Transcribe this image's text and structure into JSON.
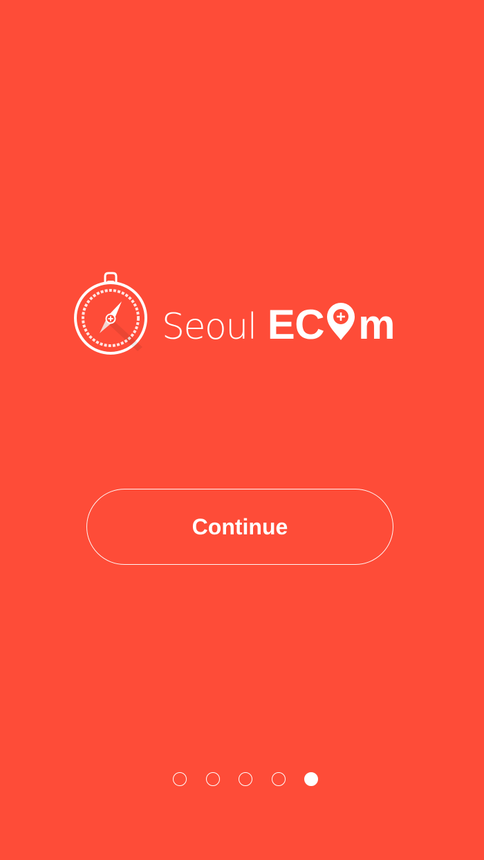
{
  "colors": {
    "background": "#FE4C38",
    "foreground": "#FFFFFF"
  },
  "logo": {
    "icon": "compass-icon",
    "brand_light": "Seoul",
    "brand_bold_prefix": "EC",
    "brand_bold_suffix": "m",
    "pin_icon": "location-pin-plus-icon"
  },
  "continue_button": {
    "label": "Continue"
  },
  "pager": {
    "total": 5,
    "active_index": 4
  }
}
